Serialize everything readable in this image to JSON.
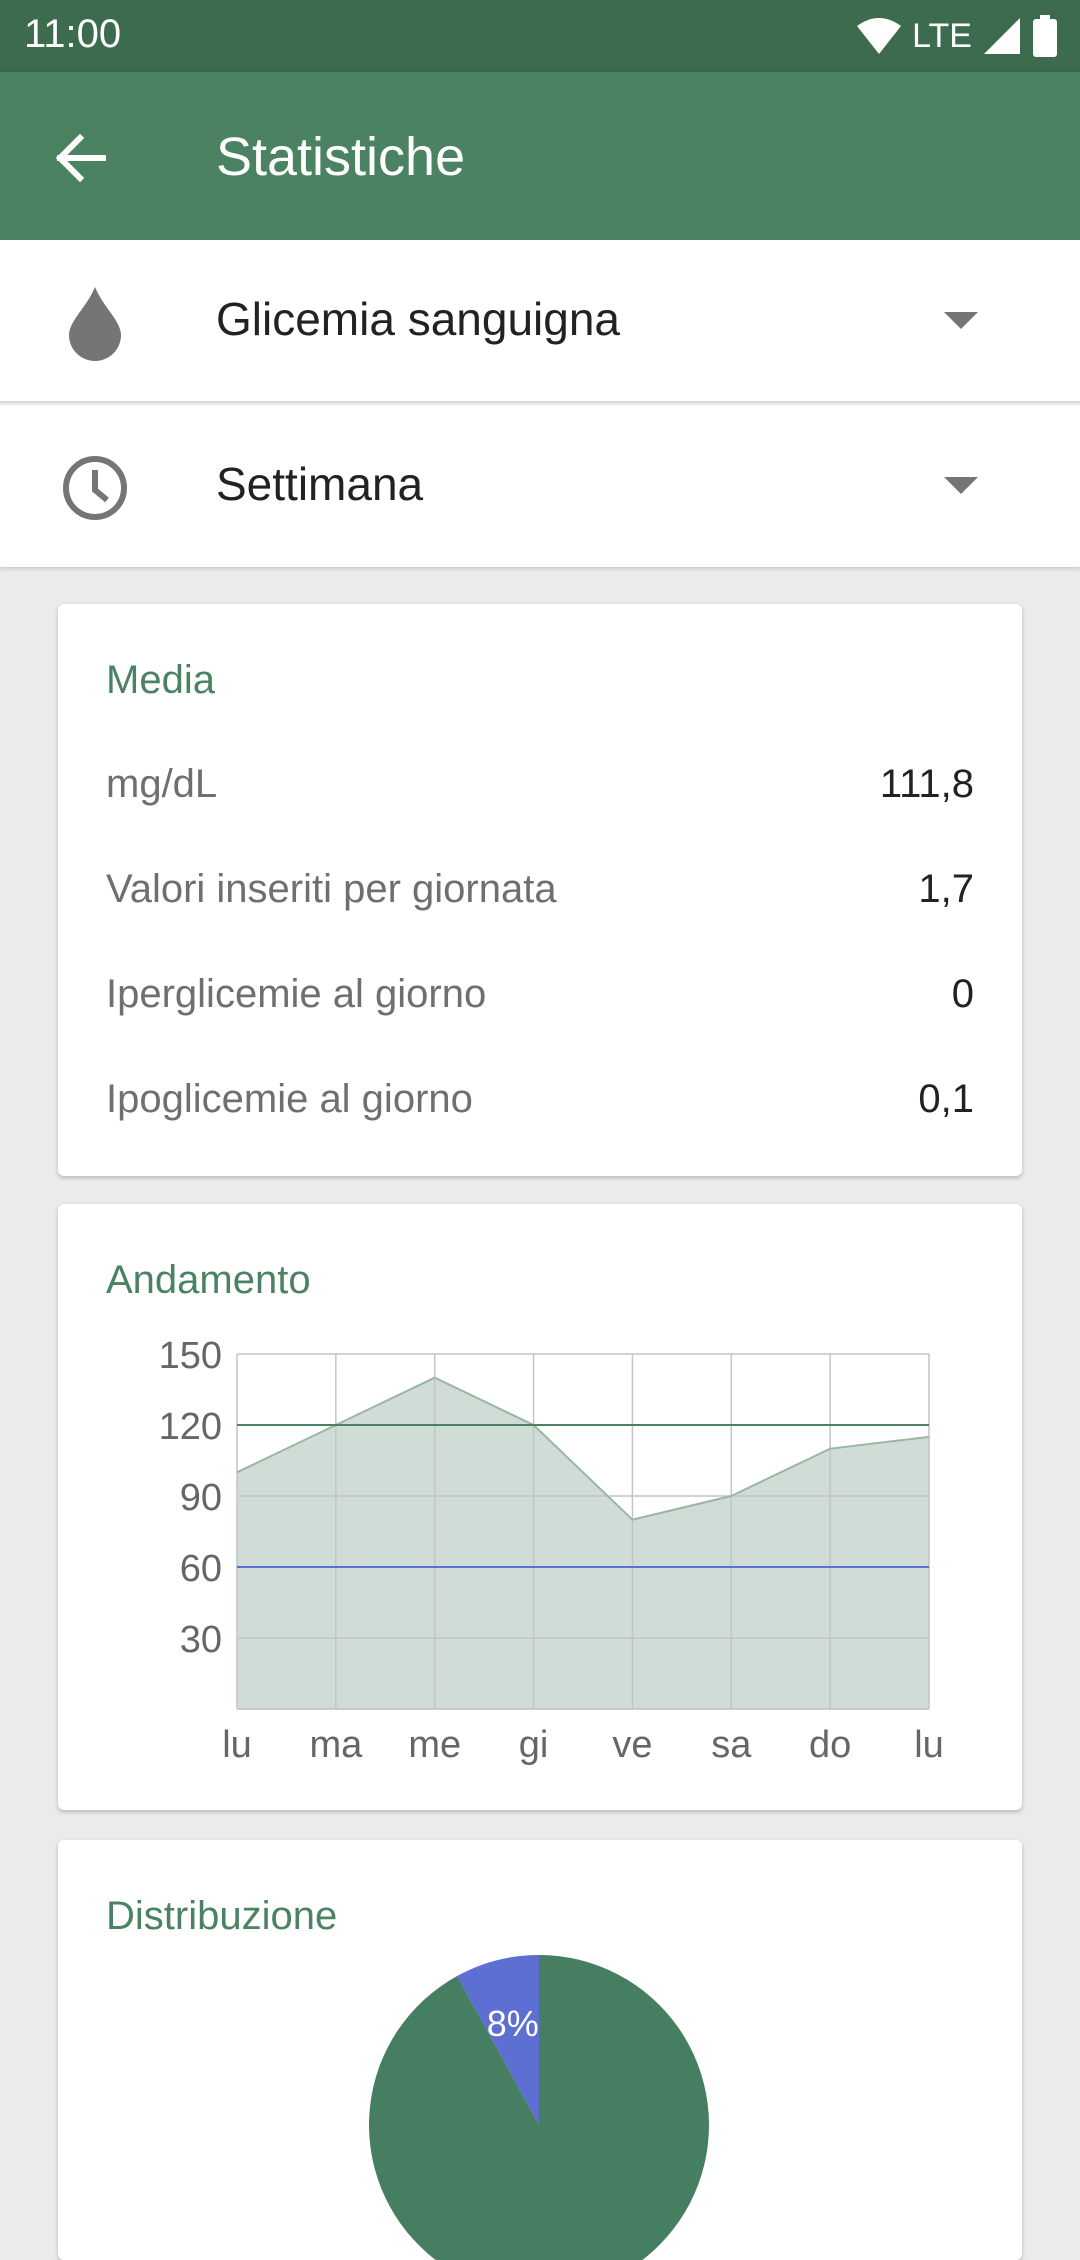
{
  "status_bar": {
    "time": "11:00",
    "network": "LTE"
  },
  "app_bar": {
    "title": "Statistiche",
    "back_icon": "arrow-back-icon"
  },
  "selectors": [
    {
      "icon": "drop-icon",
      "label": "Glicemia sanguigna"
    },
    {
      "icon": "clock-icon",
      "label": "Settimana"
    }
  ],
  "media_card": {
    "title": "Media",
    "rows": [
      {
        "label": "mg/dL",
        "value": "111,8"
      },
      {
        "label": "Valori inseriti per giornata",
        "value": "1,7"
      },
      {
        "label": "Iperglicemie al giorno",
        "value": "0"
      },
      {
        "label": "Ipoglicemie al giorno",
        "value": "0,1"
      }
    ]
  },
  "trend_card": {
    "title": "Andamento"
  },
  "distribution_card": {
    "title": "Distribuzione"
  },
  "colors": {
    "app_bar": "#4a8262",
    "status_bar": "#3c6b4e",
    "accent": "#4a8262",
    "area_fill": "#cfddd6",
    "upper_limit_line": "#4a8262",
    "lower_limit_line": "#5b6fd6",
    "pie_main": "#467e62",
    "pie_low": "#5d6fd3"
  },
  "chart_data": [
    {
      "type": "area",
      "categories": [
        "lu",
        "ma",
        "me",
        "gi",
        "ve",
        "sa",
        "do",
        "lu"
      ],
      "values": [
        100,
        120,
        140,
        120,
        80,
        90,
        110,
        115
      ],
      "ylim": [
        0,
        150
      ],
      "yticks": [
        30,
        60,
        90,
        120,
        150
      ],
      "reference_lines": [
        120,
        60
      ],
      "grid": true
    },
    {
      "type": "pie",
      "slices": [
        {
          "value": 92,
          "label": ""
        },
        {
          "value": 8,
          "label": "8%"
        }
      ]
    }
  ]
}
